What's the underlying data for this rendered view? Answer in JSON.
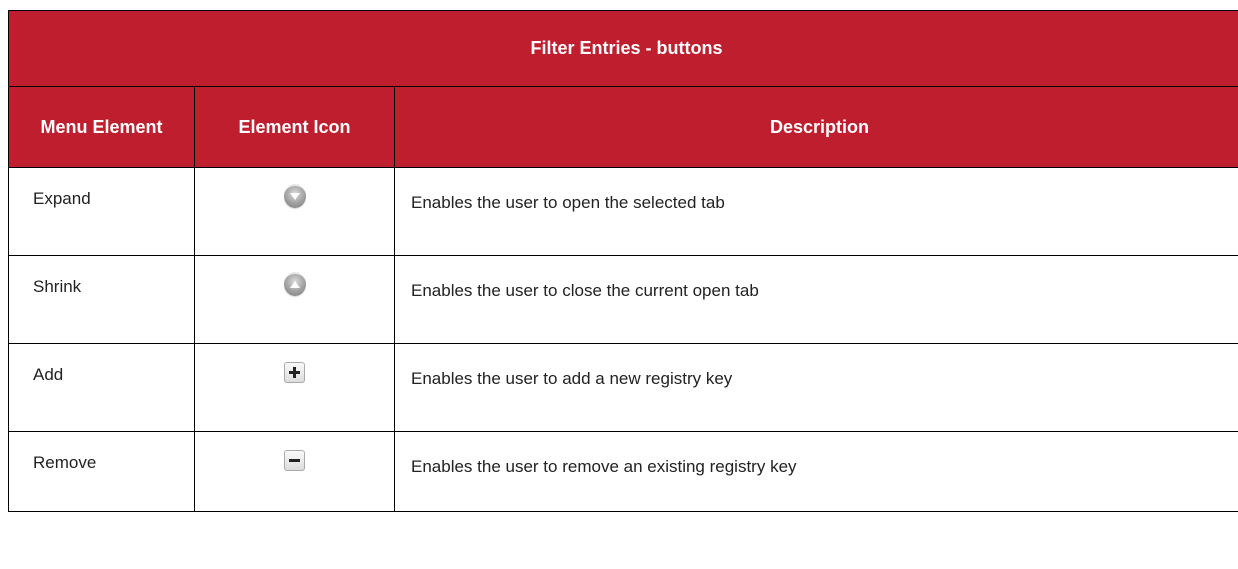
{
  "table": {
    "title": "Filter Entries - buttons",
    "headers": {
      "menu_element": "Menu Element",
      "element_icon": "Element Icon",
      "description": "Description"
    },
    "rows": [
      {
        "name": "Expand",
        "icon": "chevron-down-circle-icon",
        "description": "Enables the user to open the selected tab"
      },
      {
        "name": "Shrink",
        "icon": "chevron-up-circle-icon",
        "description": "Enables the user to close the current open tab"
      },
      {
        "name": "Add",
        "icon": "plus-icon",
        "description": "Enables the user to add a new registry key"
      },
      {
        "name": "Remove",
        "icon": "minus-icon",
        "description": "Enables the user to remove an existing registry key"
      }
    ]
  },
  "colors": {
    "header_bg": "#be1e2d",
    "header_text": "#ffffff",
    "border": "#000000"
  }
}
